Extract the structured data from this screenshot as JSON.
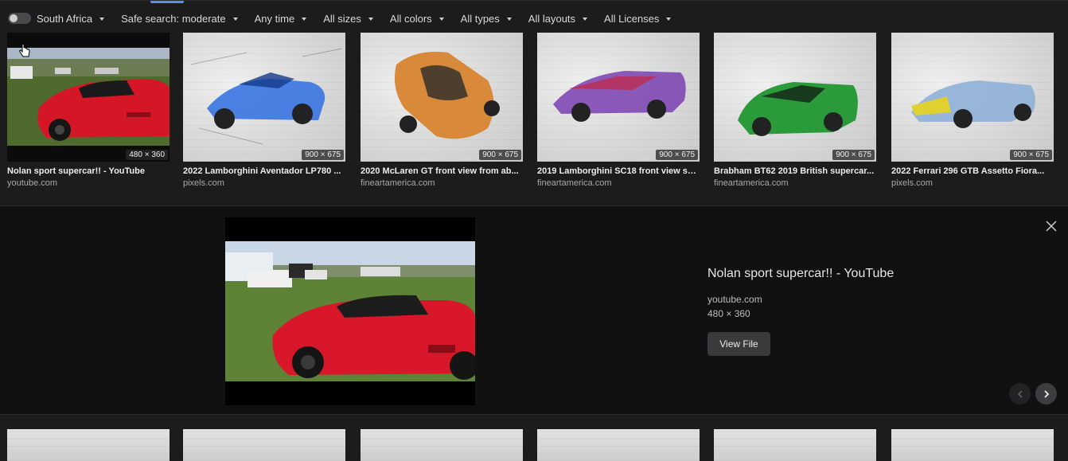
{
  "filters": {
    "region_toggle_label": "South Africa",
    "items": [
      {
        "label": "Safe search: moderate"
      },
      {
        "label": "Any time"
      },
      {
        "label": "All sizes"
      },
      {
        "label": "All colors"
      },
      {
        "label": "All types"
      },
      {
        "label": "All layouts"
      },
      {
        "label": "All Licenses"
      }
    ]
  },
  "results": [
    {
      "title": "Nolan sport supercar!! - YouTube",
      "source": "youtube.com",
      "dims": "480 × 360"
    },
    {
      "title": "2022 Lamborghini Aventador LP780 ...",
      "source": "pixels.com",
      "dims": "900 × 675"
    },
    {
      "title": "2020 McLaren GT front view from ab...",
      "source": "fineartamerica.com",
      "dims": "900 × 675"
    },
    {
      "title": "2019 Lamborghini SC18 front view su...",
      "source": "fineartamerica.com",
      "dims": "900 × 675"
    },
    {
      "title": "Brabham BT62 2019 British supercar...",
      "source": "fineartamerica.com",
      "dims": "900 × 675"
    },
    {
      "title": "2022 Ferrari 296 GTB Assetto Fiora...",
      "source": "pixels.com",
      "dims": "900 × 675"
    }
  ],
  "detail": {
    "title": "Nolan sport supercar!! - YouTube",
    "source": "youtube.com",
    "dims": "480 × 360",
    "view_file_label": "View File"
  },
  "colors": {
    "accent": "#5b8df5",
    "car_blue": "#2f6fe0",
    "car_orange": "#d88a3a",
    "car_purple": "#7a3fb0",
    "car_green": "#2a9a3a",
    "car_yellow_blue": "#e0d030",
    "car_red": "#d8182a"
  }
}
